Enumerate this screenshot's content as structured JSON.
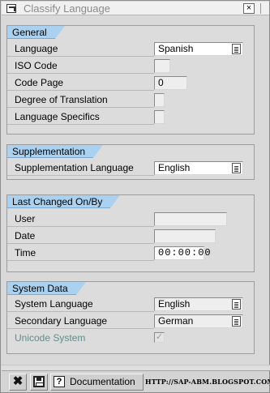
{
  "window": {
    "title": "Classify Language",
    "close_glyph": "×"
  },
  "general": {
    "header": "General",
    "language_label": "Language",
    "language_value": "Spanish",
    "iso_code_label": "ISO Code",
    "iso_code_value": "",
    "code_page_label": "Code Page",
    "code_page_value": "0",
    "degree_label": "Degree of Translation",
    "degree_value": "",
    "specifics_label": "Language Specifics",
    "specifics_value": ""
  },
  "supplementation": {
    "header": "Supplementation",
    "supp_language_label": "Supplementation Language",
    "supp_language_value": "English"
  },
  "last_changed": {
    "header": "Last Changed On/By",
    "user_label": "User",
    "user_value": "",
    "date_label": "Date",
    "date_value": "",
    "time_label": "Time",
    "time_value": "00:00:00"
  },
  "system_data": {
    "header": "System Data",
    "system_language_label": "System Language",
    "system_language_value": "English",
    "secondary_language_label": "Secondary Language",
    "secondary_language_value": "German",
    "unicode_label": "Unicode System",
    "unicode_checked": true,
    "check_glyph": "✓"
  },
  "toolbar": {
    "cancel_glyph": "✖",
    "help_glyph": "?",
    "documentation_label": "Documentation",
    "watermark": "HTTP://SAP-ABM.BLOGSPOT.COM"
  },
  "icons": {
    "title": "window-icon",
    "dropdown": "value-help-icon",
    "cancel": "cancel-icon",
    "save": "save-icon",
    "help": "help-icon"
  }
}
